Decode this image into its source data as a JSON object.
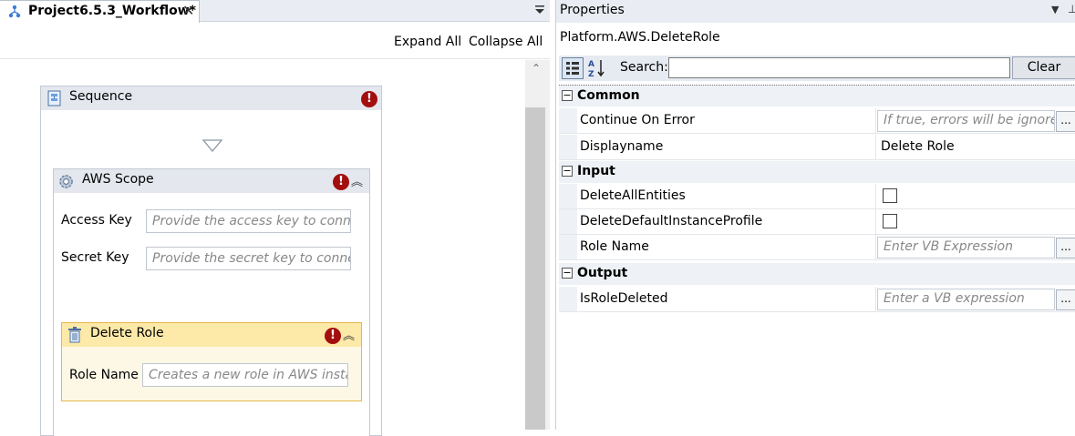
{
  "designer": {
    "tab_title": "Project6.5.3_Workflow*",
    "tab_close": "✕",
    "expand_all": "Expand All",
    "collapse_all": "Collapse All",
    "sequence": {
      "title": "Sequence",
      "error_badge": "!"
    },
    "aws_scope": {
      "title": "AWS Scope",
      "error_badge": "!",
      "fields": [
        {
          "label": "Access Key",
          "placeholder": "Provide the access key to connect"
        },
        {
          "label": "Secret Key",
          "placeholder": "Provide the secret key to connect"
        }
      ]
    },
    "delete_role": {
      "title": "Delete Role",
      "error_badge": "!",
      "fields": [
        {
          "label": "Role Name",
          "placeholder": "Creates a new role in AWS instance"
        }
      ]
    }
  },
  "properties": {
    "panel_title": "Properties",
    "type_name": "Platform.AWS.DeleteRole",
    "search_label": "Search:",
    "search_value": "",
    "clear_label": "Clear",
    "ellipsis": "...",
    "categories": [
      {
        "name": "Common",
        "rows": [
          {
            "name": "Continue On Error",
            "placeholder": "If true, errors will be ignored"
          },
          {
            "name": "Displayname",
            "value": "Delete Role"
          }
        ]
      },
      {
        "name": "Input",
        "rows": [
          {
            "name": "DeleteAllEntities",
            "checked": false
          },
          {
            "name": "DeleteDefaultInstanceProfile",
            "checked": false
          },
          {
            "name": "Role Name",
            "placeholder": "Enter VB Expression"
          }
        ]
      },
      {
        "name": "Output",
        "rows": [
          {
            "name": "IsRoleDeleted",
            "placeholder": "Enter a VB expression"
          }
        ]
      }
    ]
  },
  "colors": {
    "error_red": "#a30e0e",
    "selected_activity_fill": "#fdf0c6",
    "selected_activity_border": "#e6b84c"
  }
}
